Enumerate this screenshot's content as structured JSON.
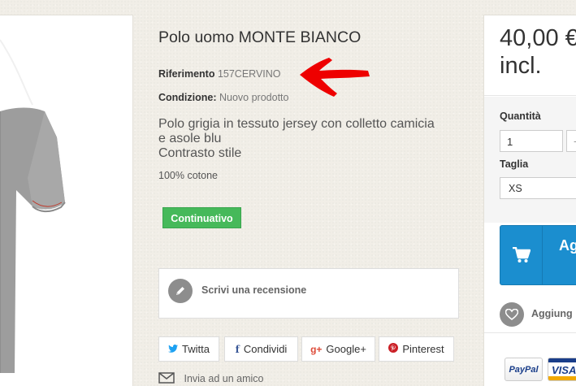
{
  "product": {
    "title": "Polo uomo MONTE BIANCO",
    "reference_label": "Riferimento",
    "reference_value": "157CERVINO",
    "condition_label": "Condizione:",
    "condition_value": "Nuovo prodotto",
    "description_lines": [
      "Polo grigia in tessuto jersey con colletto camicia",
      "e asole blu",
      "Contrasto stile"
    ],
    "material": "100% cotone",
    "status_badge": "Continuativo"
  },
  "review": {
    "label": "Scrivi una recensione",
    "icon": "pencil-icon"
  },
  "social": [
    {
      "label": "Twitta",
      "icon": "twitter-icon"
    },
    {
      "label": "Condividi",
      "icon": "facebook-icon"
    },
    {
      "label": "Google+",
      "icon": "google-plus-icon"
    },
    {
      "label": "Pinterest",
      "icon": "pinterest-icon"
    }
  ],
  "send_friend": {
    "label": "Invia ad un amico",
    "icon": "envelope-icon"
  },
  "buy_box": {
    "price": "40,00 €",
    "price_suffix": "incl.",
    "quantity_label": "Quantità",
    "quantity_value": "1",
    "quantity_minus": "-",
    "size_label": "Taglia",
    "size_value": "XS",
    "cart_label": "Ag",
    "cart_label_2": "(",
    "wishlist_label": "Aggiung",
    "payment_methods": [
      "PayPal",
      "VISA"
    ]
  },
  "colors": {
    "accent": "#1b8ecf",
    "badge": "#46b95a",
    "arrow": "#ee0000",
    "background": "#f1eee7"
  }
}
